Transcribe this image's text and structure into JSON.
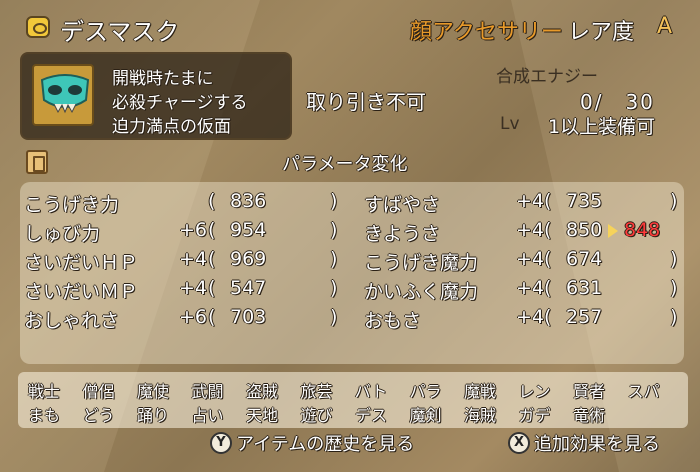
{
  "header": {
    "item_name": "デスマスク",
    "category": "顔アクセサリー",
    "rarity_label": "レア度",
    "rarity_value": "A"
  },
  "item": {
    "description": [
      "開戦時たまに",
      "必殺チャージする",
      "迫力満点の仮面"
    ],
    "trade_status": "取り引き不可",
    "synthesis_label": "合成エナジー",
    "synthesis_value": "0/　30",
    "lv_label": "Lv",
    "lv_value": "1以上装備可"
  },
  "params": {
    "title": "パラメータ変化",
    "left": [
      {
        "name": "こうげき力",
        "bonus": "",
        "open": "(",
        "value": "836",
        "close": ")"
      },
      {
        "name": "しゅび力",
        "bonus": "+6",
        "open": "(",
        "value": "954",
        "close": ")"
      },
      {
        "name": "さいだいＨＰ",
        "bonus": "+4",
        "open": "(",
        "value": "969",
        "close": ")"
      },
      {
        "name": "さいだいＭＰ",
        "bonus": "+4",
        "open": "(",
        "value": "547",
        "close": ")"
      },
      {
        "name": "おしゃれさ",
        "bonus": "+6",
        "open": "(",
        "value": "703",
        "close": ")"
      }
    ],
    "right": [
      {
        "name": "すばやさ",
        "bonus": "+4",
        "open": "(",
        "value": "735",
        "close": ")"
      },
      {
        "name": "きようさ",
        "bonus": "+4",
        "open": "(",
        "value": "850",
        "close": "",
        "new_value": "848"
      },
      {
        "name": "こうげき魔力",
        "bonus": "+4",
        "open": "(",
        "value": "674",
        "close": ")"
      },
      {
        "name": "かいふく魔力",
        "bonus": "+4",
        "open": "(",
        "value": "631",
        "close": ")"
      },
      {
        "name": "おもさ",
        "bonus": "+4",
        "open": "(",
        "value": "257",
        "close": ")"
      }
    ]
  },
  "jobs": {
    "row1": [
      "戦士",
      "僧侶",
      "魔使",
      "武闘",
      "盗賊",
      "旅芸",
      "バト",
      "パラ",
      "魔戦",
      "レン",
      "賢者",
      "スパ"
    ],
    "row2": [
      "まも",
      "どう",
      "踊り",
      "占い",
      "天地",
      "遊び",
      "デス",
      "魔剣",
      "海賊",
      "ガデ",
      "竜術"
    ]
  },
  "footer": {
    "left_button": "Y",
    "left_label": "アイテムの歴史を見る",
    "right_button": "X",
    "right_label": "追加効果を見る"
  },
  "colors": {
    "accent_orange": "#e89a2a",
    "rarity_gold": "#f4c25a",
    "decrease_red": "#ff3b3b"
  }
}
